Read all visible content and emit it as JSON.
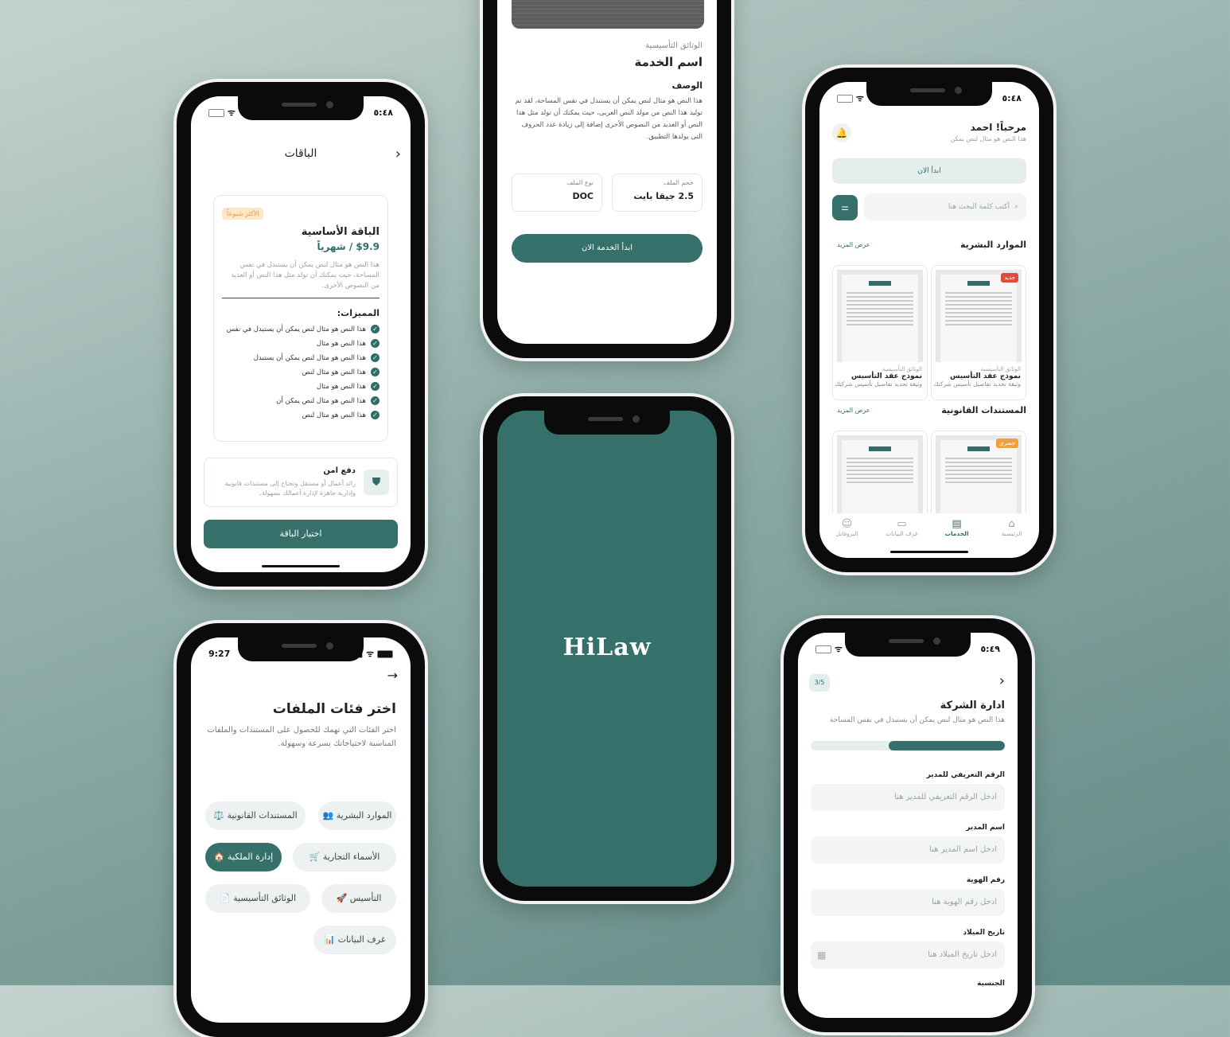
{
  "plans_screen": {
    "time": "٥:٤٨",
    "title": "الباقات",
    "badge": "الأكثر شيوعاً",
    "plan_name": "الباقة الأساسية",
    "price": "$9.9 / شهرياً",
    "description": "هذا النص هو مثال لنص يمكن أن يستبدل في نفس المساحة، حيث يمكنك أن تولد مثل هذا النص أو العديد من النصوص الأخرى.",
    "features_title": "المميزات:",
    "features": [
      "هذا النص هو مثال لنص يمكن أن يستبدل في نفس",
      "هذا النص هو مثال",
      "هذا النص هو مثال لنص يمكن أن يستبدل",
      "هذا النص هو مثال لنص",
      "هذا النص هو مثال",
      "هذا النص هو مثال لنص يمكن أن",
      "هذا النص هو مثال لنص"
    ],
    "secure_title": "دفع امن",
    "secure_desc": "رائد أعمال أو مستقل وتحتاج إلى مستندات قانونية وإدارية جاهزة لإدارة أعمالك بسهولة.",
    "cta": "اختيار الباقة"
  },
  "service_screen": {
    "category": "الوثائق التأسيسية",
    "title": "اسم الخدمة",
    "desc_title": "الوصف",
    "description": "هذا النص هو مثال لنص يمكن أن يستبدل في نفس المساحة، لقد تم توليد هذا النص من مولد النص العربى، حيث يمكنك أن تولد مثل هذا النص أو العديد من النصوص الأخرى إضافة إلى زيادة عدد الحروف التى يولدها التطبيق.",
    "size_label": "حجم الملف",
    "size_value": "2.5 جيقا بايت",
    "type_label": "نوع الملف",
    "type_value": "DOC",
    "cta": "ابدأ الخدمة الان"
  },
  "home_screen": {
    "time": "٥:٤٨",
    "greeting": "مرحباً! احمد",
    "subtitle": "هذا النص هو مثال لنص يمكن",
    "start_btn": "ابدأ الان",
    "search_placeholder": "أكتب كلمة البحث هنا",
    "sections": [
      {
        "title": "الموارد البشرية",
        "more": "عرض المزيد",
        "cards": [
          {
            "badge": "جديد",
            "category": "الوثائق التأسيسية",
            "name": "نموذج عقد التأسيس",
            "desc": "وثيقة تحديد تفاصيل تأسيس شركتك"
          },
          {
            "badge": "",
            "category": "الوثائق التأسيسية",
            "name": "نموذج عقد التأسيس",
            "desc": "وثيقة تحديد تفاصيل تأسيس شركتك"
          }
        ]
      },
      {
        "title": "المستندات القانونية",
        "more": "عرض المزيد",
        "cards": [
          {
            "badge": "حصري",
            "category": "",
            "name": "",
            "desc": ""
          },
          {
            "badge": "",
            "category": "",
            "name": "",
            "desc": ""
          }
        ]
      }
    ],
    "nav": [
      "الرئيسية",
      "الخدمات",
      "غرف البيانات",
      "البروفايل"
    ]
  },
  "categories_screen": {
    "time": "9:27",
    "title": "اختر فئات الملفات",
    "subtitle": "اختر الفئات التي تهمك للحصول على المستندات والملفات المناسبة لاحتياجاتك بسرعة وسهولة.",
    "chips": [
      "👥 الموارد البشرية",
      "⚖️ المستندات القانونية",
      "🛒 الأسماء التجارية",
      "🏠 إدارة الملكية",
      "🚀 التأسيس",
      "📄 الوثائق التأسيسية",
      "📊 غرف البيانات"
    ]
  },
  "splash_screen": {
    "logo": "HiLaw",
    "bg_color": "#36706a"
  },
  "form_screen": {
    "time": "٥:٤٩",
    "step": "3/5",
    "title": "ادارة الشركة",
    "subtitle": "هذا النص هو مثال لنص يمكن أن يستبدل في نفس المساحة",
    "progress": 0.6,
    "fields": [
      {
        "label": "الرقم التعريفي للمدير",
        "placeholder": "ادخل الرقم التعريفي للمدير هنا"
      },
      {
        "label": "اسم المدير",
        "placeholder": "ادخل اسم المدير هنا"
      },
      {
        "label": "رقم الهوية",
        "placeholder": "ادخل رقم الهوية هنا"
      },
      {
        "label": "تاريخ الميلاد",
        "placeholder": "ادخل تاريخ الميلاد هنا"
      }
    ],
    "next_label": "الجنسية"
  }
}
